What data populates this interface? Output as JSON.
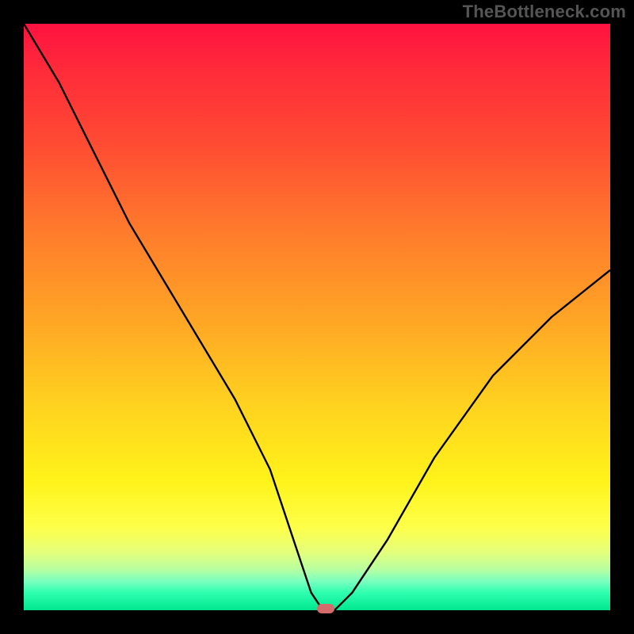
{
  "watermark": "TheBottleneck.com",
  "chart_data": {
    "type": "line",
    "title": "",
    "xlabel": "",
    "ylabel": "",
    "xlim": [
      0,
      100
    ],
    "ylim": [
      0,
      100
    ],
    "x": [
      0,
      6,
      12,
      18,
      24,
      30,
      36,
      42,
      46,
      49,
      51,
      53,
      56,
      62,
      70,
      80,
      90,
      100
    ],
    "values": [
      100,
      90,
      78,
      66,
      56,
      46,
      36,
      24,
      12,
      3,
      0,
      0,
      3,
      12,
      26,
      40,
      50,
      58
    ],
    "marker": {
      "x": 51.5,
      "y": 0
    },
    "background_gradient": {
      "top": "#ff1240",
      "mid": "#ffd21f",
      "bottom": "#00e78f"
    }
  }
}
